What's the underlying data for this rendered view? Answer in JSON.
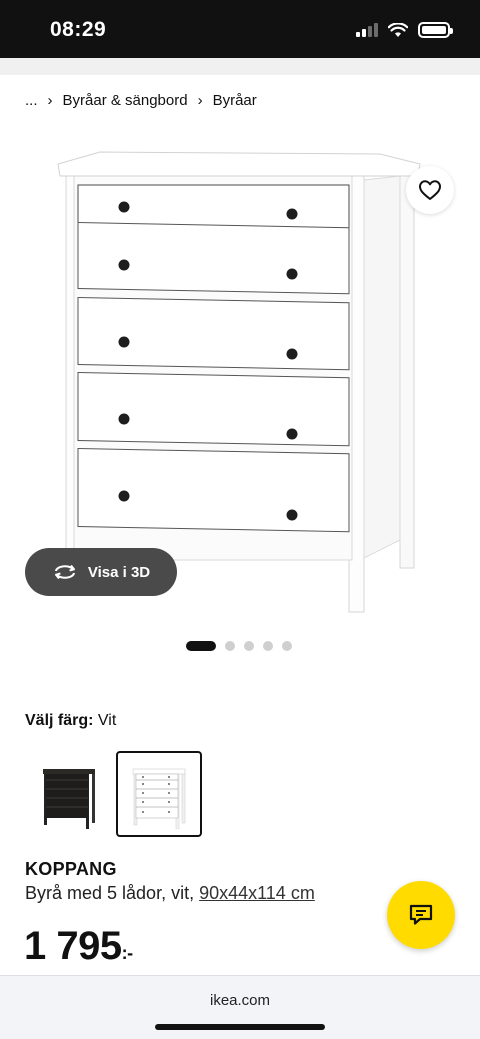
{
  "status_bar": {
    "time": "08:29"
  },
  "breadcrumb": {
    "items": [
      "...",
      "Byråar & sängbord",
      "Byråar"
    ]
  },
  "gallery": {
    "view_3d_label": "Visa i 3D",
    "dots_total": 5,
    "active_dot": 1
  },
  "color_selector": {
    "label": "Välj färg:",
    "selected_value": "Vit",
    "options": [
      "svart-brun",
      "vit"
    ],
    "selected_index": 1
  },
  "product": {
    "name": "KOPPANG",
    "description": "Byrå med 5 lådor, vit, ",
    "dimensions_link": "90x44x114 cm",
    "price": "1 795",
    "price_suffix": ":-"
  },
  "browser": {
    "address": "ikea.com"
  },
  "colors": {
    "accent_yellow": "#ffdb00",
    "dark_button": "#4a4a4a",
    "text": "#111111"
  },
  "icons": [
    "heart-icon",
    "rotate-3d-icon",
    "chat-icon",
    "wifi-icon",
    "battery-icon",
    "signal-icon"
  ]
}
